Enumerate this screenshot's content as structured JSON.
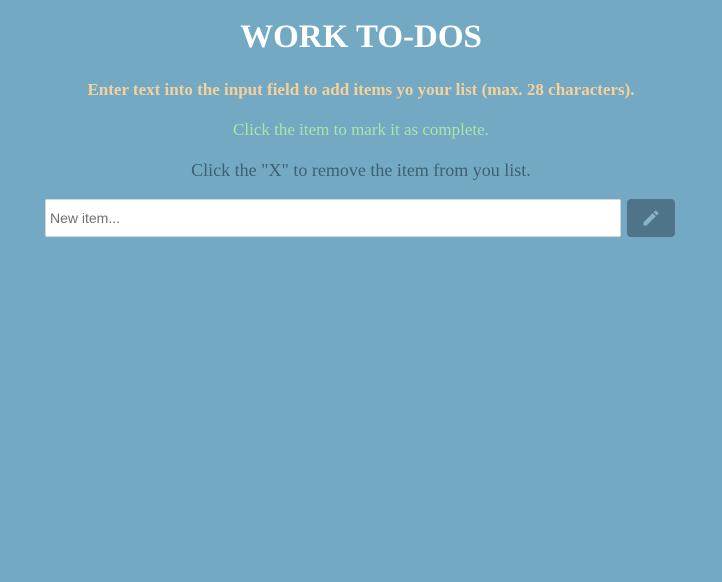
{
  "app": {
    "title": "WORK TO-DOS"
  },
  "instructions": {
    "add": "Enter text into the input field to add items yo your list (max. 28 characters).",
    "complete": "Click the item to mark it as complete.",
    "remove": "Click the \"X\" to remove the item from you list."
  },
  "new_item": {
    "value": "",
    "placeholder": "New item...",
    "max_length": 28
  },
  "add_button": {
    "icon": "pencil-icon"
  },
  "todo_items": [],
  "colors": {
    "background": "#73a9c2",
    "title": "#ffffff",
    "instruction_add": "#f5d19e",
    "instruction_complete": "#a8e6a8",
    "instruction_remove": "#3f5f72",
    "button_background": "#4f7489",
    "button_icon": "#87b4c9"
  }
}
